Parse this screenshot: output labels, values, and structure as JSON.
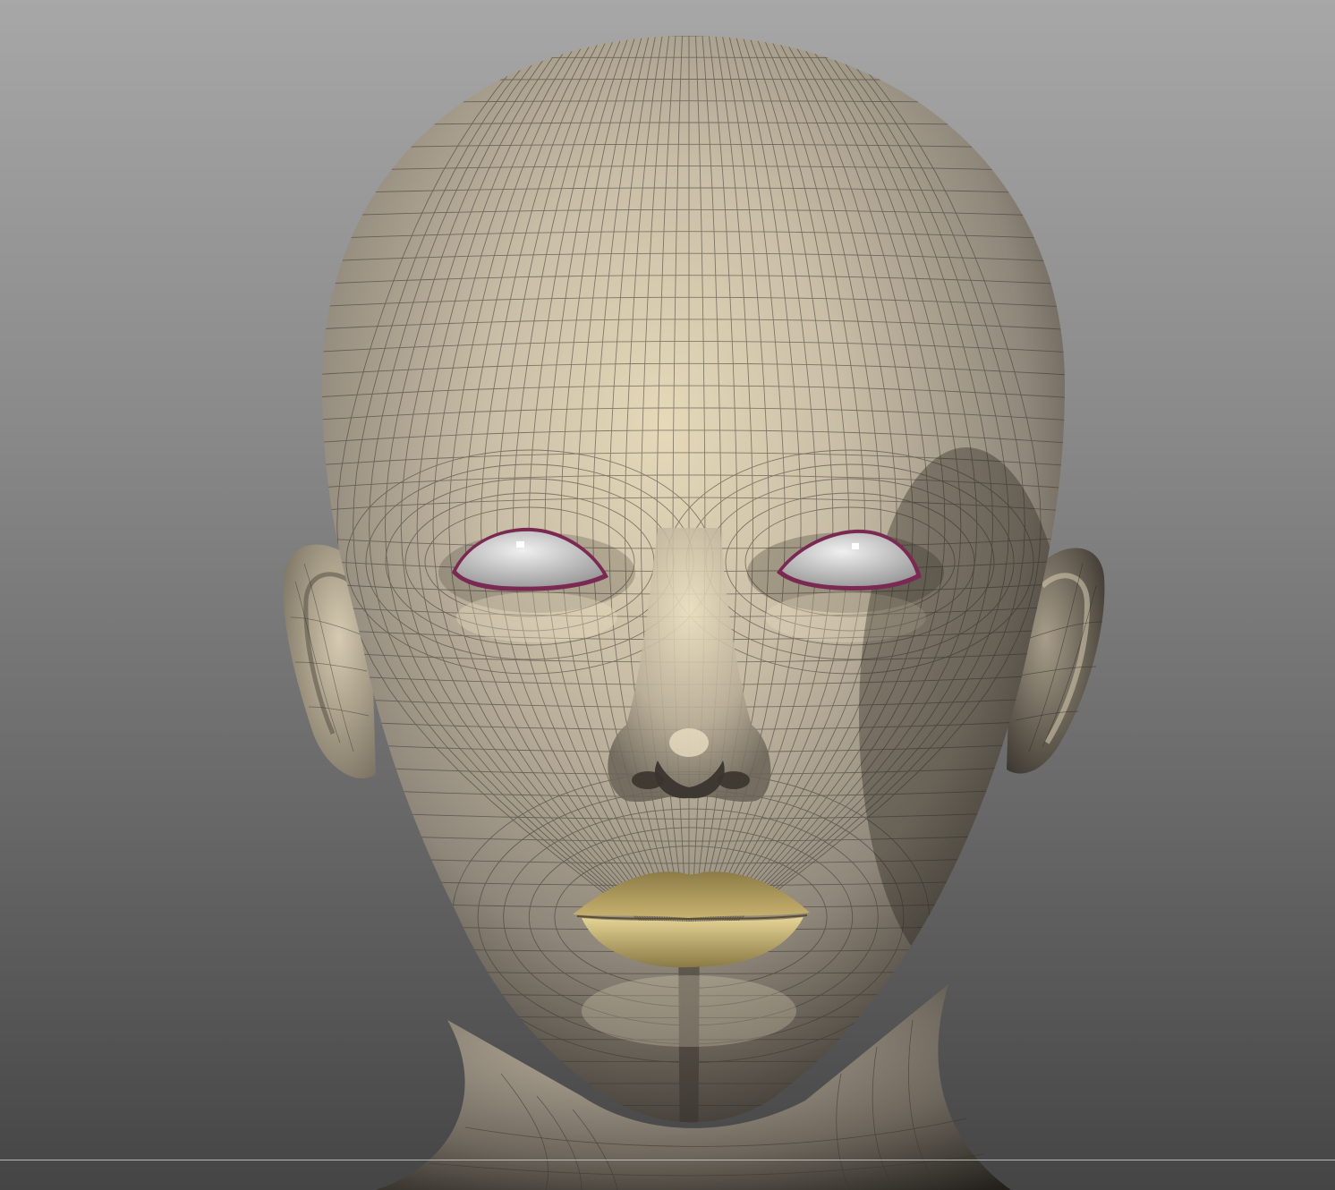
{
  "viewport": {
    "description_visible_text": "",
    "background_top": "#a7a7a7",
    "background_bottom": "#454545"
  },
  "model": {
    "skin_light": "#e8dcbd",
    "skin_mid": "#b5aa96",
    "skin_shadow": "#4a4540",
    "wire_color": "#3a352f",
    "lip_color": "#b8a45e",
    "lip_highlight": "#e0d08e",
    "eye_white": "#e4e4e4",
    "eye_rim": "#7a2a52"
  },
  "floor_line": {
    "color": "#cdcdcd"
  }
}
